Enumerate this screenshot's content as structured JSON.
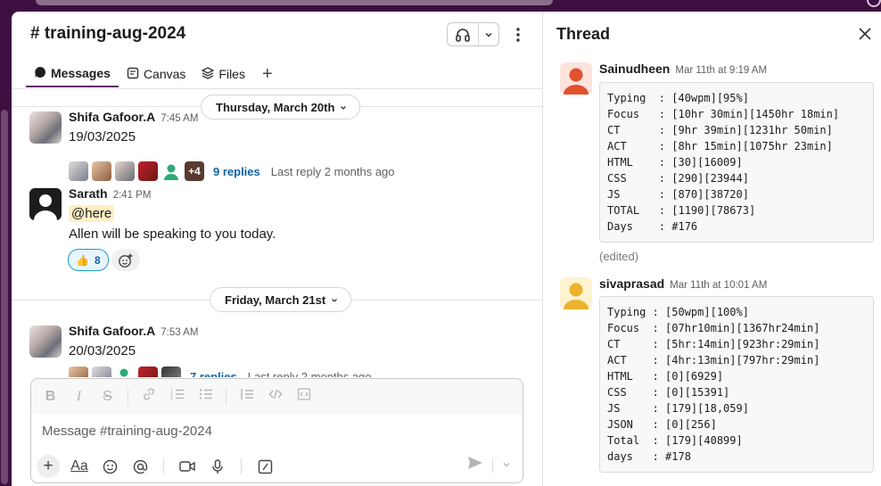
{
  "channel": {
    "title": "# training-aug-2024",
    "tabs": [
      {
        "label": "Messages",
        "icon": "chat-bubble-icon"
      },
      {
        "label": "Canvas",
        "icon": "canvas-icon"
      },
      {
        "label": "Files",
        "icon": "files-icon"
      }
    ],
    "add_tab": "+"
  },
  "messages": {
    "date1": "Thursday, March 20th",
    "date2": "Friday, March 21st",
    "m1": {
      "author": "Shifa Gafoor.A",
      "time": "7:45 AM",
      "text": "19/03/2025",
      "more_count": "+4",
      "replies": "9 replies",
      "last_reply": "Last reply 2 months ago"
    },
    "m2": {
      "author": "Sarath",
      "time": "2:41 PM",
      "mention": "@here",
      "text": "Allen will be speaking to you today.",
      "reaction_emoji": "👍",
      "reaction_count": "8"
    },
    "m3": {
      "author": "Shifa Gafoor.A",
      "time": "7:53 AM",
      "text": "20/03/2025",
      "replies": "7 replies",
      "last_reply": "Last reply 2 months ago"
    }
  },
  "composer": {
    "placeholder": "Message #training-aug-2024",
    "format_label": "Aa"
  },
  "thread": {
    "title": "Thread",
    "r1": {
      "author": "Sainudheen",
      "time": "Mar 11th at 9:19 AM",
      "code": "Typing  : [40wpm][95%]\nFocus   : [10hr 30min][1450hr 18min]\nCT      : [9hr 39min][1231hr 50min]\nACT     : [8hr 15min][1075hr 23min]\nHTML    : [30][16009]\nCSS     : [290][23944]\nJS      : [870][38720]\nTOTAL   : [1190][78673]\nDays    : #176",
      "edited": "(edited)"
    },
    "r2": {
      "author": "sivaprasad",
      "time": "Mar 11th at 10:01 AM",
      "code": "Typing : [50wpm][100%]\nFocus  : [07hr10min][1367hr24min]\nCT     : [5hr:14min][923hr:29min]\nACT    : [4hr:13min][797hr:29min]\nHTML   : [0][6929]\nCSS    : [0][15391]\nJS     : [179][18,059]\nJSON   : [0][256]\nTotal  : [179][40899]\ndays   : #178"
    }
  },
  "colors": {
    "sidebar": "#3f0e40",
    "link": "#1264a3",
    "mention_bg": "#fdf0c4",
    "active_tab": "#611f69"
  }
}
